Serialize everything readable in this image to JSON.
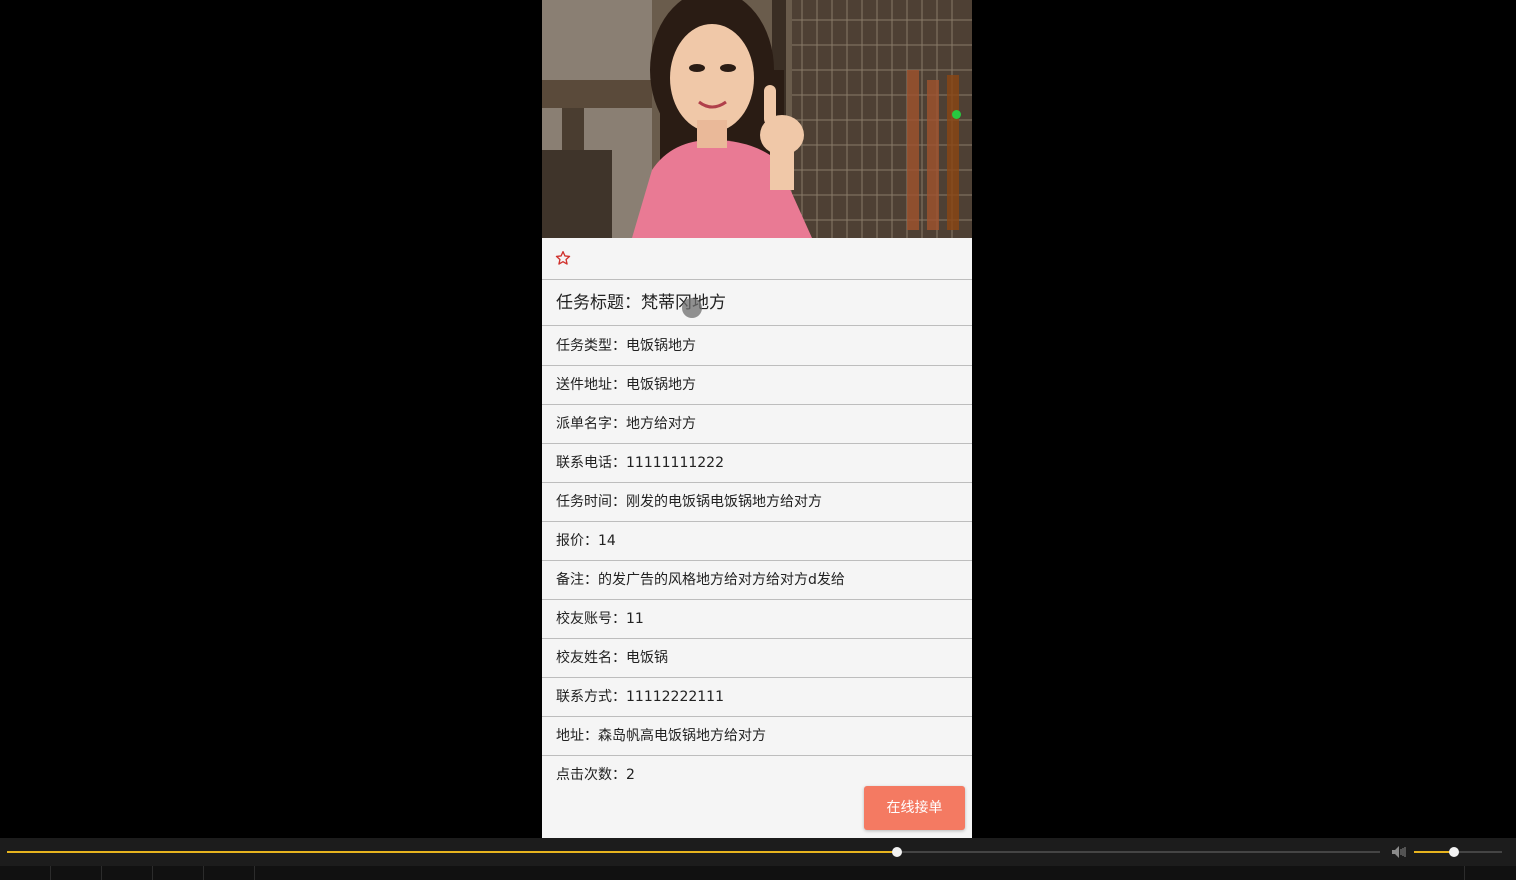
{
  "colors": {
    "accent_yellow": "#e6b31e",
    "button_bg": "#f47a62",
    "star_red": "#d0312d",
    "online_green": "#27c93f"
  },
  "icons": {
    "favorite": "star-outline-icon",
    "volume": "speaker-icon"
  },
  "task": {
    "title": "任务标题：梵蒂冈地方",
    "fields": [
      "任务类型：电饭锅地方",
      "送件地址：电饭锅地方",
      "派单名字：地方给对方",
      "联系电话：11111111222",
      "任务时间：刚发的电饭锅电饭锅地方给对方",
      "报价：14",
      "备注：的发广告的风格地方给对方给对方d发给",
      "校友账号：11",
      "校友姓名：电饭锅",
      "联系方式：11112222111",
      "地址：森岛帆高电饭锅地方给对方",
      "点击次数：2"
    ],
    "accept_label": "在线接单"
  },
  "player": {
    "progress": 0.648,
    "volume": 0.45
  }
}
